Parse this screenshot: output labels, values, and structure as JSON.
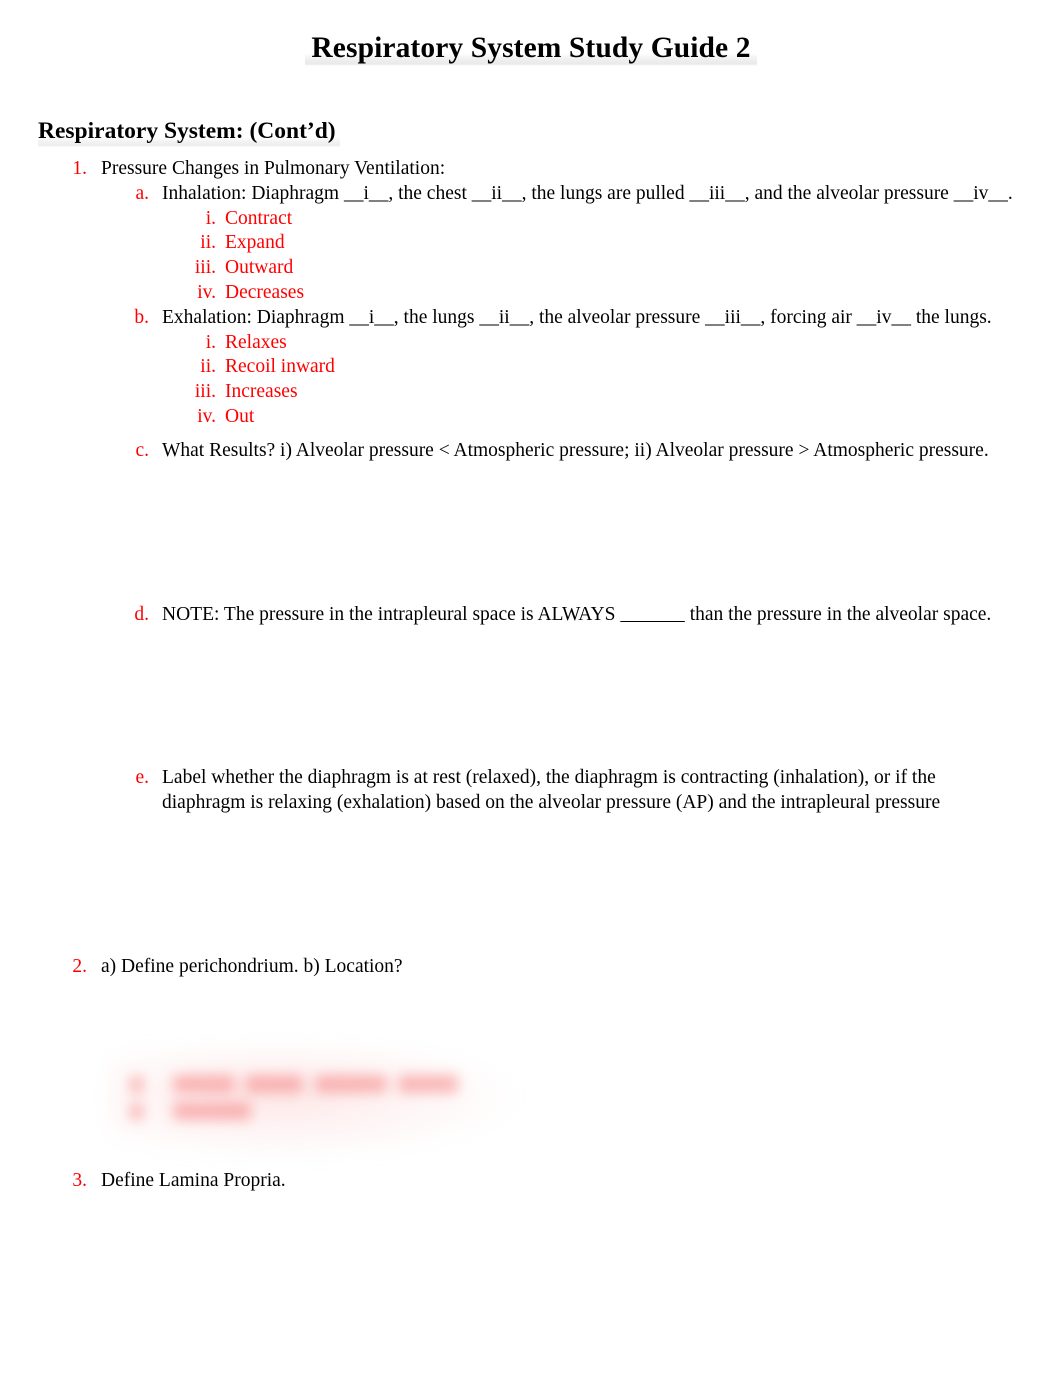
{
  "document": {
    "title": "Respiratory System Study Guide 2",
    "section_heading": "Respiratory System: (Cont’d)"
  },
  "colors": {
    "marker_red": "#FF0000",
    "body_black": "#000000",
    "page_background": "#FFFFFF",
    "title_highlight": "rgba(0,0,0,0.08)",
    "redaction_red": "rgba(244,92,92,0.42)"
  },
  "outline": {
    "item1": {
      "marker": "1.",
      "text": "Pressure Changes in Pulmonary Ventilation:",
      "sub": {
        "a": {
          "marker": "a.",
          "text": "Inhalation: Diaphragm __i__, the chest __ii__, the lungs are pulled __iii__, and the alveolar pressure __iv__.",
          "roman": [
            {
              "marker": "i.",
              "text": "Contract"
            },
            {
              "marker": "ii.",
              "text": "Expand"
            },
            {
              "marker": "iii.",
              "text": "Outward"
            },
            {
              "marker": "iv.",
              "text": "Decreases"
            }
          ]
        },
        "b": {
          "marker": "b.",
          "text": "Exhalation: Diaphragm __i__, the lungs __ii__, the alveolar pressure __iii__, forcing air __iv__ the lungs.",
          "roman": [
            {
              "marker": "i.",
              "text": "Relaxes"
            },
            {
              "marker": "ii.",
              "text": "Recoil inward"
            },
            {
              "marker": "iii.",
              "text": "Increases"
            },
            {
              "marker": "iv.",
              "text": "Out"
            }
          ]
        },
        "c": {
          "marker": "c.",
          "text": "What Results? i) Alveolar pressure < Atmospheric pressure; ii) Alveolar pressure > Atmospheric pressure."
        },
        "d": {
          "marker": "d.",
          "text_before_blank": "NOTE: The pressure in the intrapleural space is ALWAYS ",
          "blank": "            ",
          "text_after_blank": " than the pressure in the alveolar space."
        },
        "e": {
          "marker": "e.",
          "text": "Label whether the diaphragm is at rest (relaxed), the diaphragm is contracting (inhalation), or if the diaphragm is relaxing (exhalation) based on the alveolar pressure (AP) and the intrapleural pressure"
        }
      }
    },
    "item2": {
      "marker": "2.",
      "text": "a) Define perichondrium. b) Location?",
      "answer_redacted": true
    },
    "item3": {
      "marker": "3.",
      "text": "Define Lamina Propria."
    }
  }
}
